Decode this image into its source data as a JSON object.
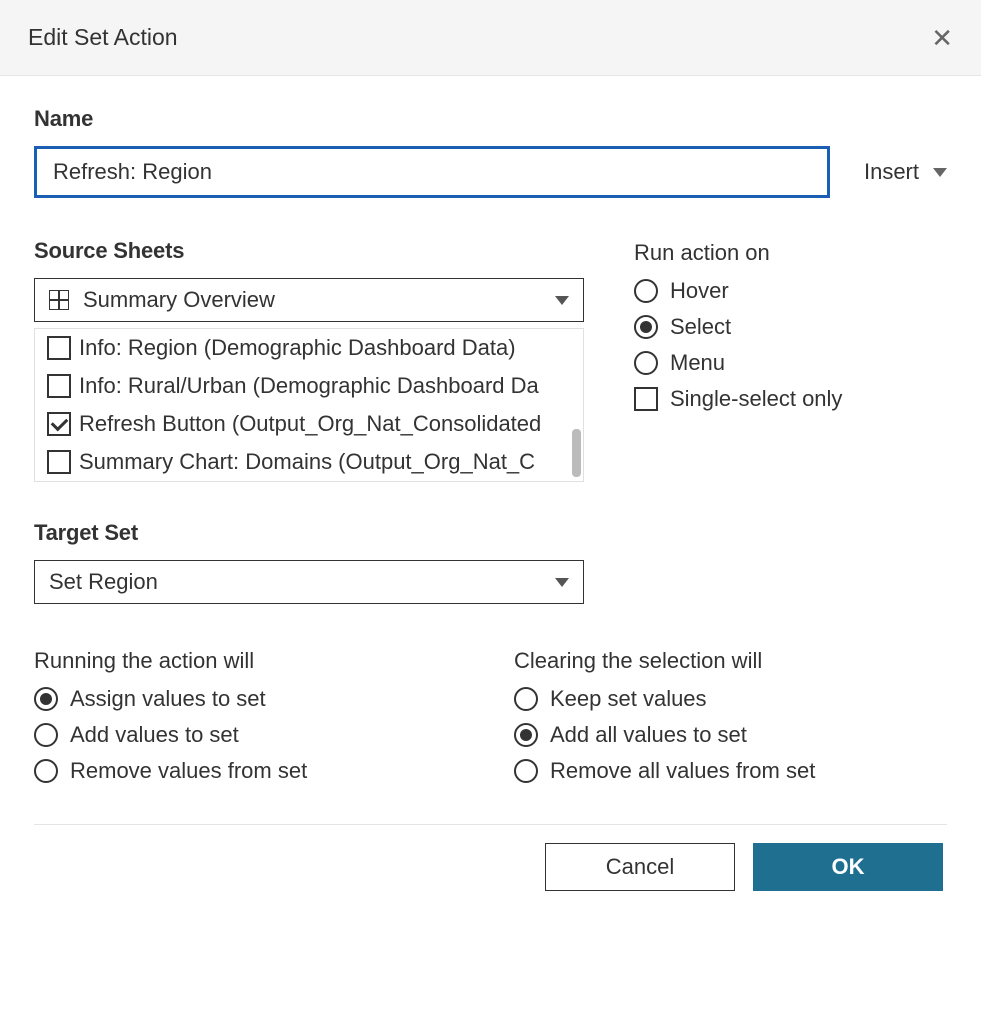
{
  "dialog": {
    "title": "Edit Set Action"
  },
  "name": {
    "label": "Name",
    "value": "Refresh: Region",
    "insert_label": "Insert"
  },
  "source": {
    "label": "Source Sheets",
    "selected": "Summary Overview",
    "items": [
      {
        "label": "Info: Region (Demographic Dashboard Data)",
        "checked": false
      },
      {
        "label": "Info: Rural/Urban (Demographic Dashboard Da",
        "checked": false
      },
      {
        "label": "Refresh Button (Output_Org_Nat_Consolidated",
        "checked": true
      },
      {
        "label": "Summary Chart: Domains (Output_Org_Nat_C",
        "checked": false
      }
    ]
  },
  "run_on": {
    "label": "Run action on",
    "options": {
      "hover": {
        "label": "Hover",
        "checked": false
      },
      "select": {
        "label": "Select",
        "checked": true
      },
      "menu": {
        "label": "Menu",
        "checked": false
      }
    },
    "single_select": {
      "label": "Single-select only",
      "checked": false
    }
  },
  "target": {
    "label": "Target Set",
    "selected": "Set Region"
  },
  "running": {
    "label": "Running the action will",
    "options": {
      "assign": {
        "label": "Assign values to set",
        "checked": true
      },
      "add": {
        "label": "Add values to set",
        "checked": false
      },
      "remove": {
        "label": "Remove values from set",
        "checked": false
      }
    }
  },
  "clearing": {
    "label": "Clearing the selection will",
    "options": {
      "keep": {
        "label": "Keep set values",
        "checked": false
      },
      "add_all": {
        "label": "Add all values to set",
        "checked": true
      },
      "remove_all": {
        "label": "Remove all values from set",
        "checked": false
      }
    }
  },
  "footer": {
    "cancel": "Cancel",
    "ok": "OK"
  }
}
